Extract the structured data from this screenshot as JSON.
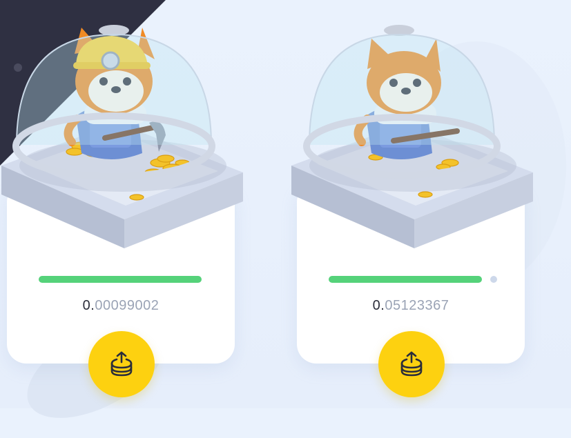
{
  "miners": [
    {
      "progress": 1.0,
      "amount_int": "0.",
      "amount_dec": "00099002",
      "has_helmet": true,
      "collect_icon": "upload-coins-icon"
    },
    {
      "progress": 0.94,
      "amount_int": "0.",
      "amount_dec": "05123367",
      "has_helmet": false,
      "collect_icon": "upload-coins-icon"
    }
  ],
  "colors": {
    "progress": "#55d27a",
    "button": "#fdd110",
    "corner": "#2f3042"
  }
}
